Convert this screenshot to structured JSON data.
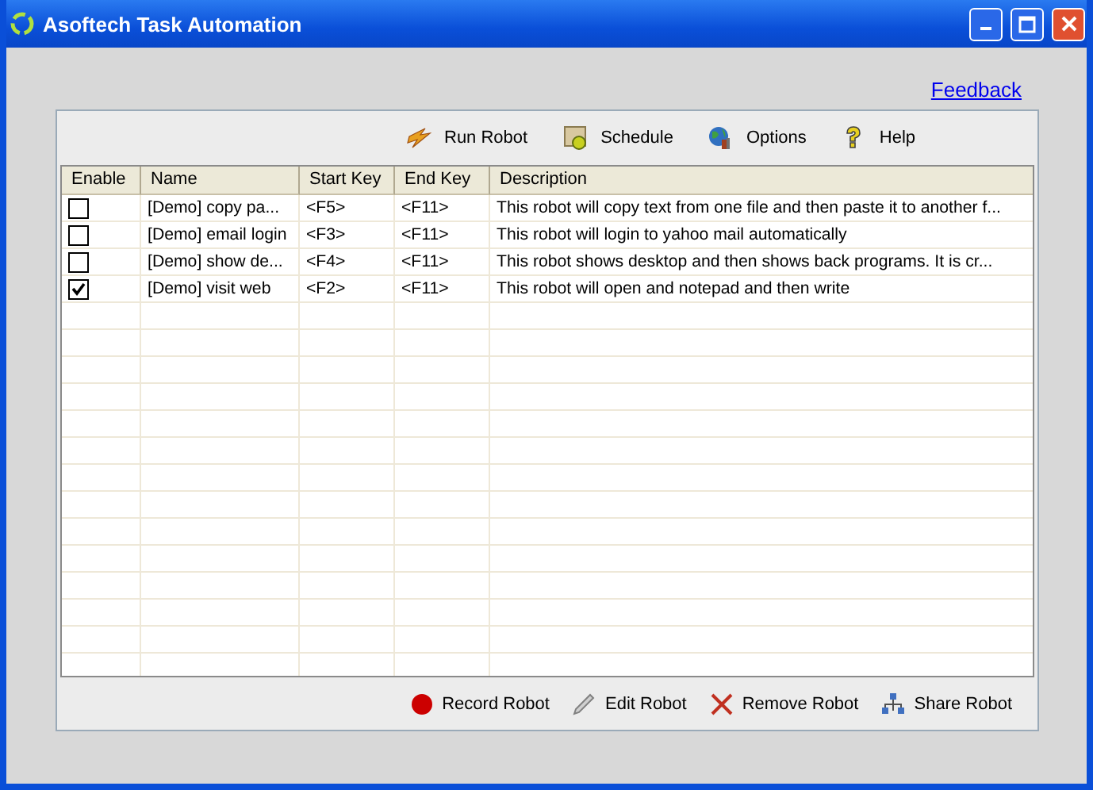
{
  "window": {
    "title": "Asoftech Task Automation"
  },
  "feedback_link": "Feedback",
  "toolbar": [
    {
      "kind": "run",
      "label": "Run Robot"
    },
    {
      "kind": "schedule",
      "label": "Schedule"
    },
    {
      "kind": "options",
      "label": "Options"
    },
    {
      "kind": "help",
      "label": "Help"
    }
  ],
  "table": {
    "columns": [
      "Enable",
      "Name",
      "Start Key",
      "End Key",
      "Description"
    ],
    "rows": [
      {
        "checked": false,
        "name": "[Demo] copy pa...",
        "start_key": "<F5>",
        "end_key": "<F11>",
        "description": "This robot will copy text from one file and then paste it to another f..."
      },
      {
        "checked": false,
        "name": "[Demo] email login",
        "start_key": "<F3>",
        "end_key": "<F11>",
        "description": "This robot will login to yahoo mail automatically"
      },
      {
        "checked": false,
        "name": "[Demo] show de...",
        "start_key": "<F4>",
        "end_key": "<F11>",
        "description": "This robot shows desktop and then shows back programs. It is cr..."
      },
      {
        "checked": true,
        "name": "[Demo] visit web",
        "start_key": "<F2>",
        "end_key": "<F11>",
        "description": "This robot will open and notepad and then write"
      }
    ]
  },
  "actions": [
    {
      "kind": "record",
      "label": "Record Robot"
    },
    {
      "kind": "edit",
      "label": "Edit Robot"
    },
    {
      "kind": "remove",
      "label": "Remove Robot"
    },
    {
      "kind": "share",
      "label": "Share Robot"
    }
  ]
}
